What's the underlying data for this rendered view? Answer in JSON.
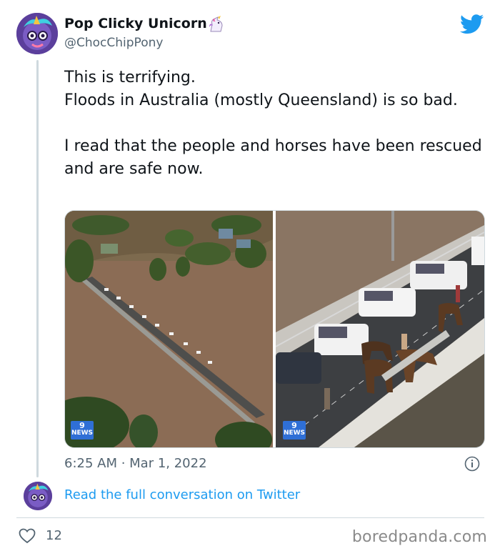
{
  "author": {
    "display_name": "Pop Clicky Unicorn",
    "handle": "@ChocChipPony",
    "avatar_icon": "unicorn-avatar",
    "badge_icon": "unicorn-emoji"
  },
  "tweet": {
    "text": "This is terrifying.\nFloods in Australia (mostly Queensland) is so bad.\n\nI read that the people and horses have been rescued and are safe now.",
    "timestamp": "6:25 AM · Mar 1, 2022"
  },
  "media": {
    "photos": [
      {
        "description_icon": "flooded-bridge-aerial-photo",
        "logo_text": "NEWS",
        "logo_number": "9"
      },
      {
        "description_icon": "horses-on-bridge-photo",
        "logo_text": "NEWS",
        "logo_number": "9"
      }
    ]
  },
  "conversation": {
    "link_text": "Read the full conversation on Twitter"
  },
  "footer": {
    "like_count": "12",
    "watermark": "boredpanda.com"
  },
  "colors": {
    "link_blue": "#1d9bf0",
    "twitter_blue": "#1d9bf0",
    "muted_text": "#536471",
    "flood_water": "#8a6e58"
  }
}
